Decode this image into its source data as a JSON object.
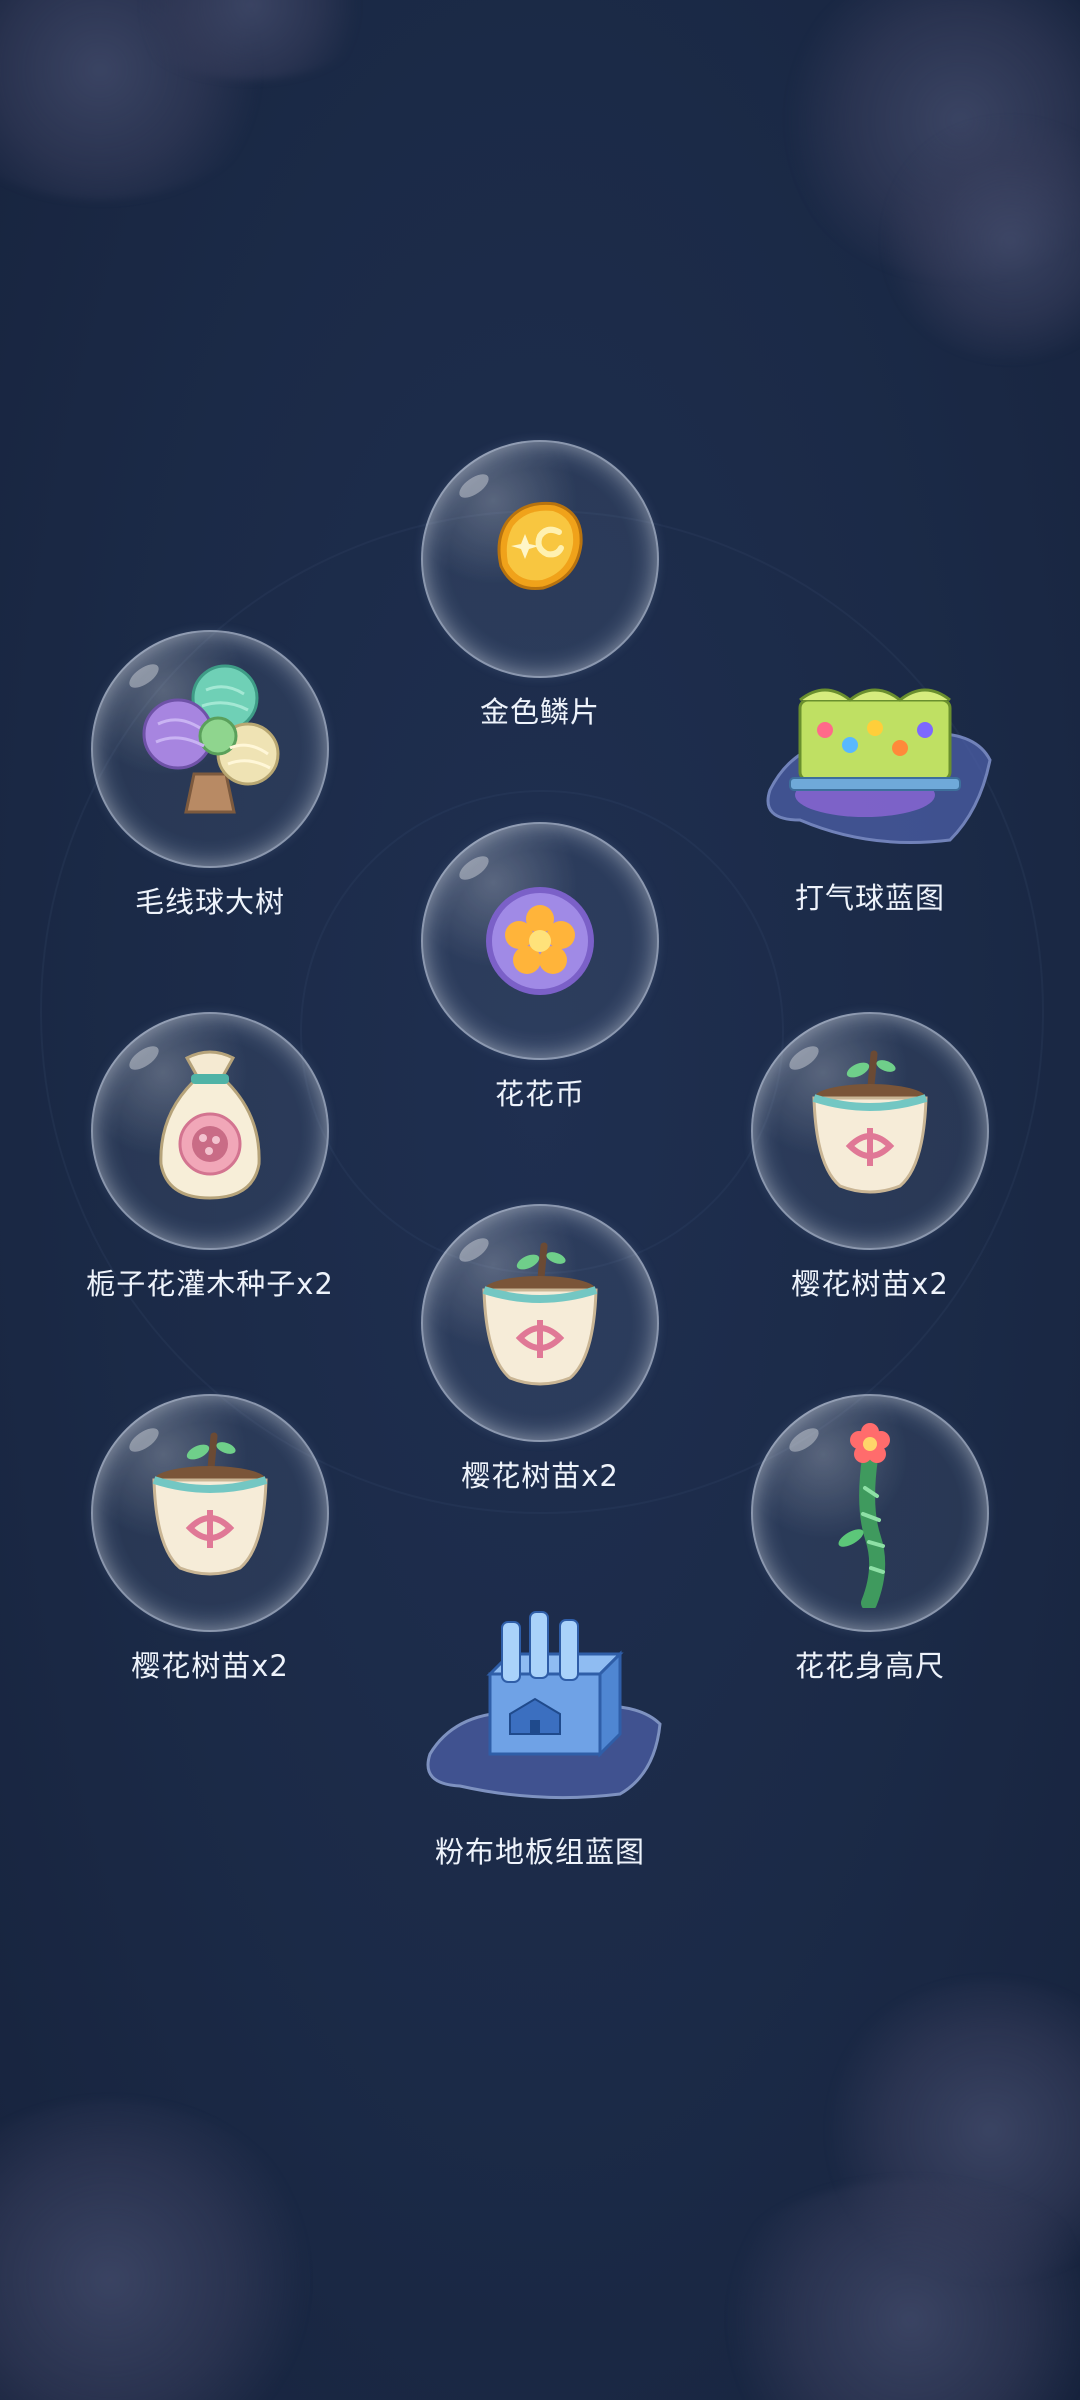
{
  "rewards": [
    {
      "label": "金色鳞片",
      "icon": "gold-scale-icon"
    },
    {
      "label": "毛线球大树",
      "icon": "yarn-tree-icon"
    },
    {
      "label": "打气球蓝图",
      "icon": "balloon-blueprint-icon"
    },
    {
      "label": "花花币",
      "icon": "flower-coin-icon"
    },
    {
      "label": "栀子花灌木种子x2",
      "icon": "seed-bag-icon"
    },
    {
      "label": "樱花树苗x2",
      "icon": "sapling-pot-icon"
    },
    {
      "label": "樱花树苗x2",
      "icon": "sapling-pot-icon"
    },
    {
      "label": "樱花树苗x2",
      "icon": "sapling-pot-icon"
    },
    {
      "label": "花花身高尺",
      "icon": "height-ruler-icon"
    },
    {
      "label": "粉布地板组蓝图",
      "icon": "floor-blueprint-icon"
    }
  ],
  "colors": {
    "background": "#1b2945",
    "label": "#eef3fb",
    "gold": "#f6b41e",
    "coin_purple": "#9d84e0",
    "cloud": "#464e6e"
  }
}
